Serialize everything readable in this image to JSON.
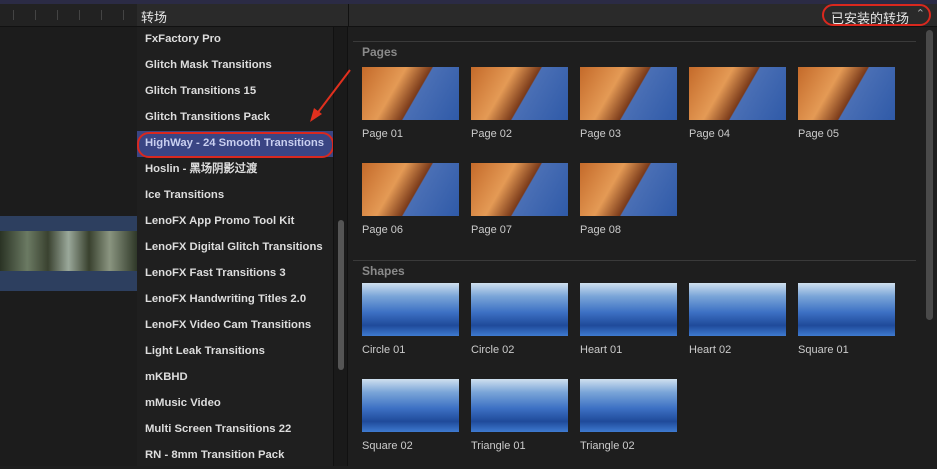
{
  "header": {
    "title": "转场",
    "picker_label": "已安装的转场"
  },
  "sidebar": {
    "items": [
      {
        "label": "FxFactory Pro"
      },
      {
        "label": "Glitch Mask Transitions"
      },
      {
        "label": "Glitch Transitions 15"
      },
      {
        "label": "Glitch Transitions Pack"
      },
      {
        "label": "HighWay - 24 Smooth Transitions",
        "selected": true
      },
      {
        "label": "Hoslin - 黑场阴影过渡"
      },
      {
        "label": "Ice Transitions"
      },
      {
        "label": "LenoFX App Promo Tool Kit"
      },
      {
        "label": "LenoFX Digital Glitch Transitions"
      },
      {
        "label": "LenoFX Fast Transitions 3"
      },
      {
        "label": "LenoFX Handwriting Titles 2.0"
      },
      {
        "label": "LenoFX Video Cam Transitions"
      },
      {
        "label": "Light Leak Transitions"
      },
      {
        "label": "mKBHD"
      },
      {
        "label": "mMusic Video"
      },
      {
        "label": "Multi Screen Transitions 22"
      },
      {
        "label": "RN - 8mm Transition Pack"
      }
    ]
  },
  "sections": [
    {
      "title": "Pages",
      "items": [
        "Page 01",
        "Page 02",
        "Page 03",
        "Page 04",
        "Page 05",
        "Page 06",
        "Page 07",
        "Page 08"
      ]
    },
    {
      "title": "Shapes",
      "items": [
        "Circle 01",
        "Circle 02",
        "Heart 01",
        "Heart 02",
        "Square 01",
        "Square 02",
        "Triangle 01",
        "Triangle 02"
      ]
    }
  ],
  "colors": {
    "highlight": "#d9281e",
    "selection": "#3a4584"
  }
}
